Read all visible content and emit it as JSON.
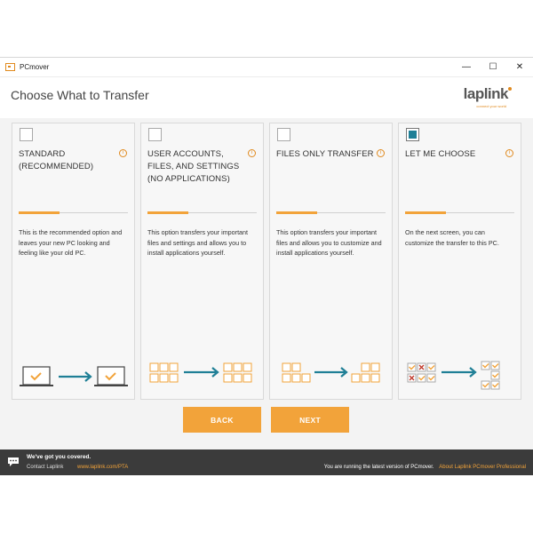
{
  "window": {
    "title": "PCmover",
    "minimize": "—",
    "maximize": "☐",
    "close": "✕"
  },
  "header": {
    "title": "Choose What to Transfer",
    "logo": "laplink",
    "logo_tagline": "connect your world"
  },
  "info_glyph": "i",
  "cards": [
    {
      "title": "STANDARD (RECOMMENDED)",
      "checked": false,
      "description": "This is the recommended option and leaves your new PC looking and feeling like your old PC."
    },
    {
      "title": "USER ACCOUNTS, FILES, AND SETTINGS (NO APPLICATIONS)",
      "checked": false,
      "description": "This option transfers your important files and settings and allows you to install applications yourself."
    },
    {
      "title": "FILES ONLY TRANSFER",
      "checked": false,
      "description": "This option transfers your important files and allows you to customize and install applications yourself."
    },
    {
      "title": "LET ME CHOOSE",
      "checked": true,
      "description": "On the next screen, you can customize the transfer to this PC."
    }
  ],
  "buttons": {
    "back": "BACK",
    "next": "NEXT"
  },
  "footer": {
    "tagline": "We've got you covered.",
    "contact": "Contact Laplink",
    "link": "www.laplink.com/PTA",
    "status": "You are running the latest version of PCmover.",
    "about": "About Laplink PCmover Professional"
  },
  "colors": {
    "accent": "#f2a33a",
    "teal": "#1f7f96",
    "footer_bg": "#3b3b3b"
  }
}
